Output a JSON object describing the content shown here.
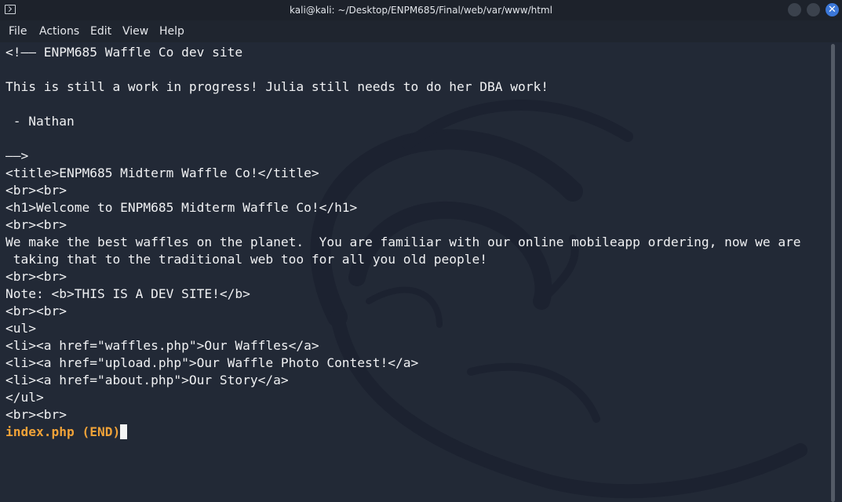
{
  "window": {
    "title": "kali@kali: ~/Desktop/ENPM685/Final/web/var/www/html",
    "close_glyph": "✕"
  },
  "menu": {
    "items": [
      {
        "label": "File"
      },
      {
        "label": "Actions"
      },
      {
        "label": "Edit"
      },
      {
        "label": "View"
      },
      {
        "label": "Help"
      }
    ]
  },
  "terminal": {
    "lines": [
      "<!—— ENPM685 Waffle Co dev site",
      "",
      "This is still a work in progress! Julia still needs to do her DBA work!",
      "",
      " - Nathan",
      "",
      "——>",
      "<title>ENPM685 Midterm Waffle Co!</title>",
      "<br><br>",
      "<h1>Welcome to ENPM685 Midterm Waffle Co!</h1>",
      "<br><br>",
      "We make the best waffles on the planet.  You are familiar with our online mobileapp ordering, now we are",
      " taking that to the traditional web too for all you old people!",
      "<br><br>",
      "Note: <b>THIS IS A DEV SITE!</b>",
      "<br><br>",
      "<ul>",
      "<li><a href=\"waffles.php\">Our Waffles</a>",
      "<li><a href=\"upload.php\">Our Waffle Photo Contest!</a>",
      "<li><a href=\"about.php\">Our Story</a>",
      "</ul>",
      "<br><br>"
    ],
    "status": "index.php (END)"
  },
  "colors": {
    "background": "#222936",
    "text": "#f0f1f3",
    "status": "#f0a238",
    "close_button": "#3b77d8"
  },
  "icons": {
    "app": "terminal-icon",
    "minimize": "minimize-button",
    "maximize": "maximize-button",
    "close": "close-icon"
  }
}
